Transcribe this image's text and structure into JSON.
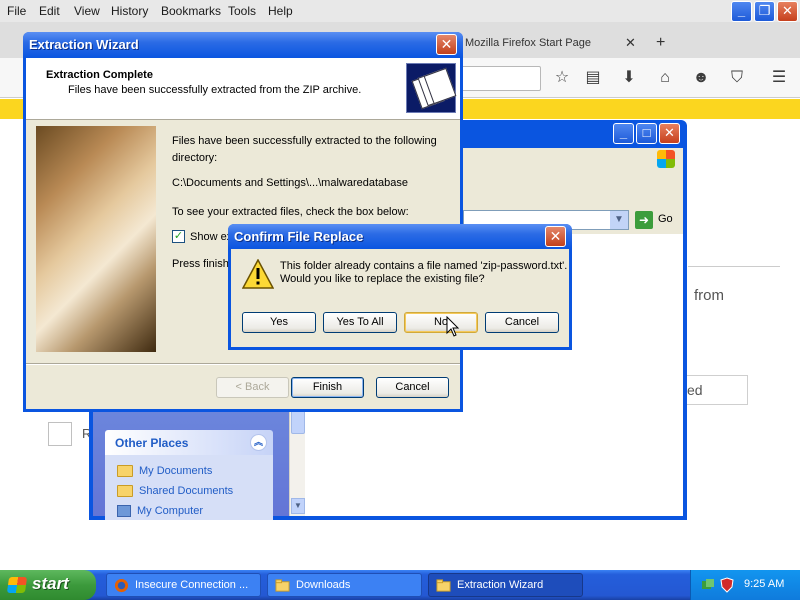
{
  "firefox": {
    "menus": [
      "File",
      "Edit",
      "View",
      "History",
      "Bookmarks",
      "Tools",
      "Help"
    ],
    "tab_title": "Mozilla Firefox Start Page",
    "content_from_text": "from",
    "content_input_text": "ed",
    "content_checkbox_label": "R"
  },
  "explorer": {
    "go_label": "Go",
    "other_places": {
      "title": "Other Places",
      "items": [
        "My Documents",
        "Shared Documents",
        "My Computer"
      ]
    }
  },
  "wizard": {
    "title": "Extraction Wizard",
    "heading": "Extraction Complete",
    "subheading": "Files have been successfully extracted from the ZIP archive.",
    "body_line1": "Files have been successfully extracted to the following",
    "body_line2": "directory:",
    "path": "C:\\Documents and Settings\\...\\malwaredatabase",
    "see_files": "To see your extracted files, check the box below:",
    "checkbox_label": "Show ex",
    "press_finish": "Press finish",
    "back_label": "< Back",
    "finish_label": "Finish",
    "cancel_label": "Cancel"
  },
  "confirm": {
    "title": "Confirm File Replace",
    "message_line1": "This folder already contains a file named 'zip-password.txt'.",
    "message_line2": "Would you like to replace the existing file?",
    "yes_label": "Yes",
    "yes_to_all_label": "Yes To All",
    "no_label": "No",
    "cancel_label": "Cancel"
  },
  "taskbar": {
    "start_label": "start",
    "tasks": [
      {
        "label": "Insecure Connection ...",
        "icon": "firefox-icon"
      },
      {
        "label": "Downloads",
        "icon": "folder-icon"
      },
      {
        "label": "Extraction Wizard",
        "icon": "folder-icon"
      }
    ],
    "clock": "9:25 AM"
  }
}
